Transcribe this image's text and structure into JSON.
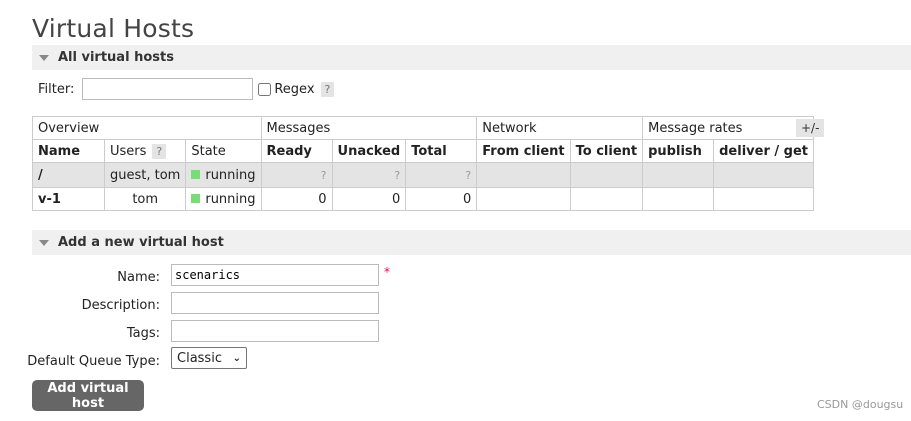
{
  "page_title": "Virtual Hosts",
  "all_vhosts_section": "All virtual hosts",
  "filter": {
    "label": "Filter:",
    "value": "",
    "regex_label": "Regex",
    "help": "?"
  },
  "table": {
    "groups": [
      "Overview",
      "Messages",
      "Network",
      "Message rates"
    ],
    "columns": [
      "Name",
      "Users",
      "State",
      "Ready",
      "Unacked",
      "Total",
      "From client",
      "To client",
      "publish",
      "deliver / get"
    ],
    "users_help": "?",
    "rows": [
      {
        "name": "/",
        "users": "guest, tom",
        "state": "running",
        "ready": "?",
        "unacked": "?",
        "total": "?",
        "from_client": "",
        "to_client": "",
        "publish": "",
        "deliver_get": ""
      },
      {
        "name": "v-1",
        "users": "tom",
        "state": "running",
        "ready": "0",
        "unacked": "0",
        "total": "0",
        "from_client": "",
        "to_client": "",
        "publish": "",
        "deliver_get": ""
      }
    ],
    "plus_minus": "+/-"
  },
  "add_section": "Add a new virtual host",
  "form": {
    "name_label": "Name:",
    "name_value": "scenarics",
    "required_mark": "*",
    "description_label": "Description:",
    "tags_label": "Tags:",
    "queue_type_label": "Default Queue Type:",
    "queue_type_value": "Classic",
    "submit_label": "Add virtual host"
  },
  "watermark": "CSDN @dougsu",
  "colors": {
    "running": "#77dd77",
    "button_bg": "#666666",
    "section_bg": "#f0f0f0"
  }
}
